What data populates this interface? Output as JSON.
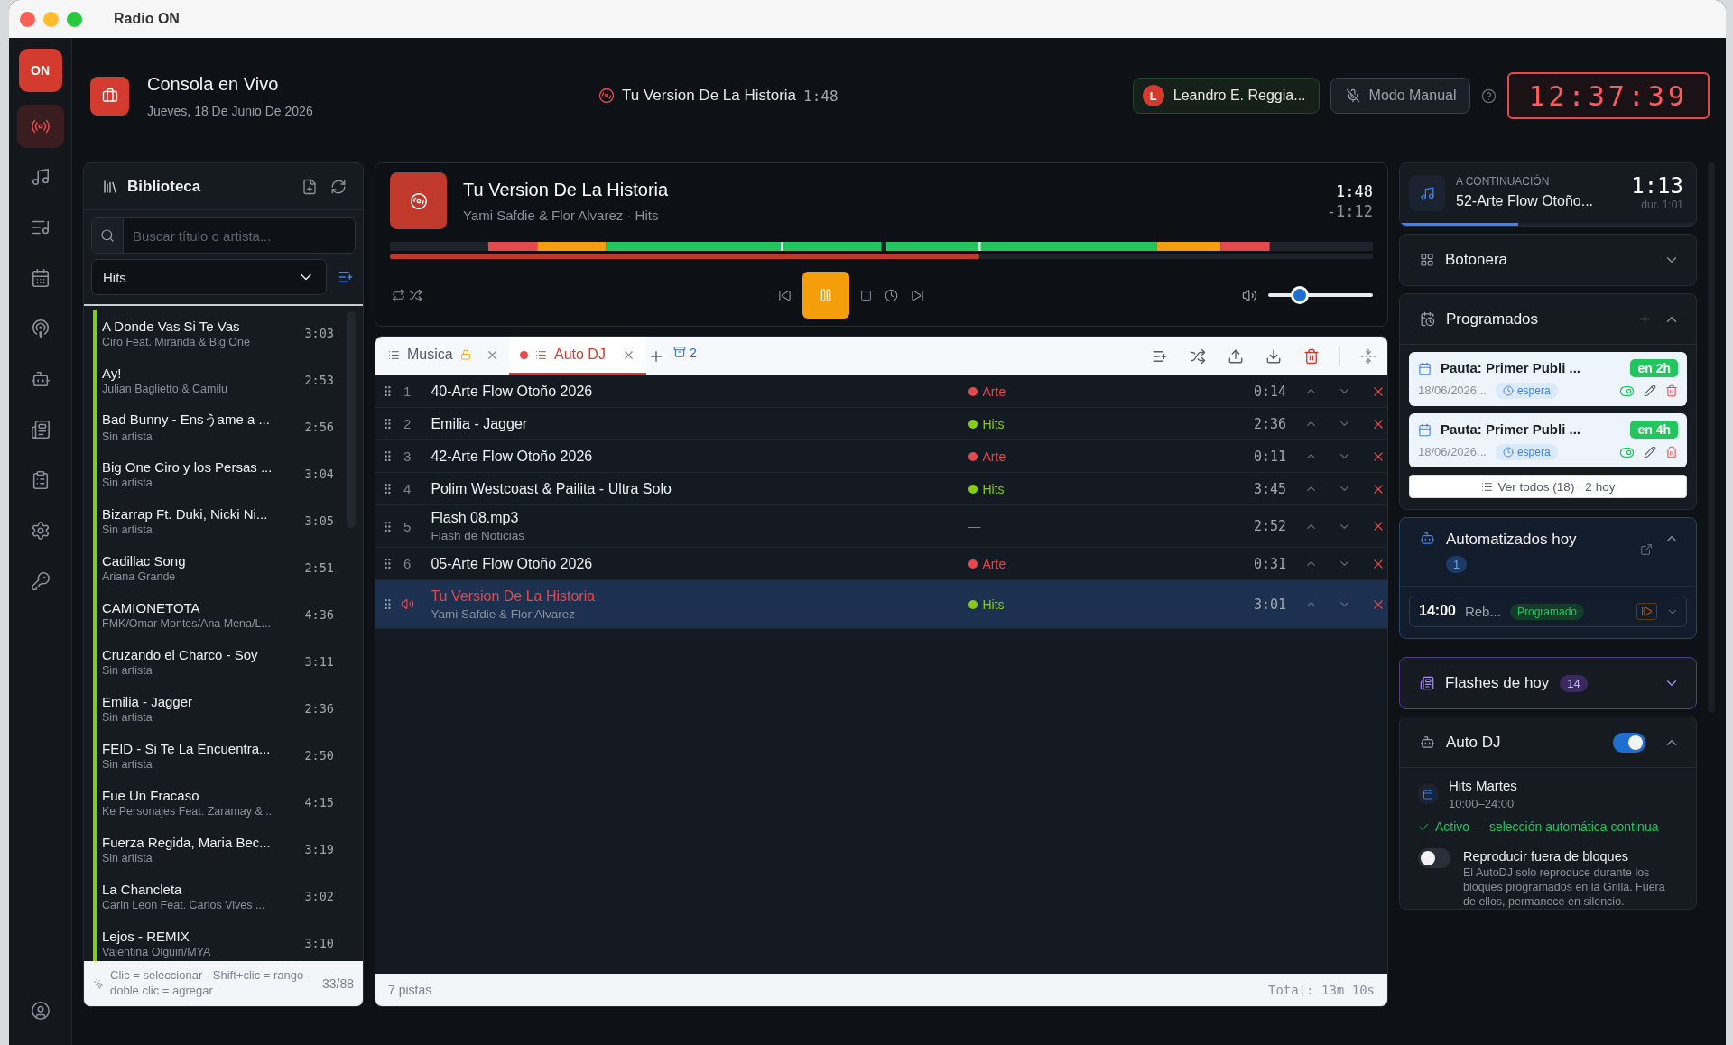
{
  "window": {
    "title": "Radio ON"
  },
  "rail": {
    "logo": "ON",
    "items": [
      {
        "selected": true
      },
      {
        "selected": false
      },
      {
        "selected": false
      },
      {
        "selected": false
      },
      {
        "selected": false
      },
      {
        "selected": false
      },
      {
        "selected": false
      },
      {
        "selected": false
      },
      {
        "selected": false
      },
      {
        "selected": false
      }
    ]
  },
  "header": {
    "title": "Consola en Vivo",
    "date": "Jueves, 18 De Junio De 2026",
    "now_playing": {
      "title": "Tu Version De La Historia",
      "time": "1:48"
    },
    "user": {
      "initial": "L",
      "name": "Leandro E. Reggia..."
    },
    "mode_button": "Modo Manual",
    "clock": "12:37:39"
  },
  "library": {
    "title": "Biblioteca",
    "search": {
      "placeholder": "Buscar título o artista..."
    },
    "filter": "Hits",
    "tracks": [
      {
        "title": "A Donde Vas Si Te Vas",
        "artist": "Ciro Feat. Miranda & Big One",
        "duration": "3:03"
      },
      {
        "title": "Ay!",
        "artist": "Julian Baglietto & Camilu",
        "duration": "2:53"
      },
      {
        "title": "Bad Bunny - Ensうame a ...",
        "artist": "Sin artista",
        "duration": "2:56"
      },
      {
        "title": "Big One Ciro y los Persas ...",
        "artist": "Sin artista",
        "duration": "3:04"
      },
      {
        "title": "Bizarrap Ft. Duki, Nicki Ni...",
        "artist": "Sin artista",
        "duration": "3:05"
      },
      {
        "title": "Cadillac Song",
        "artist": "Ariana Grande",
        "duration": "2:51"
      },
      {
        "title": "CAMIONETOTA",
        "artist": "FMK/Omar Montes/Ana Mena/L...",
        "duration": "4:36"
      },
      {
        "title": "Cruzando el Charco - Soy",
        "artist": "Sin artista",
        "duration": "3:11"
      },
      {
        "title": "Emilia - Jagger",
        "artist": "Sin artista",
        "duration": "2:36"
      },
      {
        "title": "FEID - Si Te La Encuentra...",
        "artist": "Sin artista",
        "duration": "2:50"
      },
      {
        "title": "Fue Un Fracaso",
        "artist": "Ke Personajes Feat. Zaramay &...",
        "duration": "4:15"
      },
      {
        "title": "Fuerza Regida, Maria Bec...",
        "artist": "Sin artista",
        "duration": "3:19"
      },
      {
        "title": "La Chancleta",
        "artist": "Carin Leon Feat. Carlos Vives ...",
        "duration": "3:02"
      },
      {
        "title": "Lejos - REMIX",
        "artist": "Valentina Olguin/MYA",
        "duration": "3:10"
      }
    ],
    "hint": "Clic = seleccionar · Shift+clic = rango · doble clic = agregar",
    "count": "33/88"
  },
  "player": {
    "title": "Tu Version De La Historia",
    "subtitle": "Yami Safdie & Flor Alvarez · Hits",
    "elapsed": "1:48",
    "remaining": "-1:12",
    "level": 0.6,
    "playing": true,
    "volume": {
      "level": 0.3
    }
  },
  "playlist": {
    "tabs": [
      {
        "label": "Musica",
        "selected": false,
        "live": false,
        "locked": true
      },
      {
        "label": "Auto DJ",
        "selected": true,
        "live": true,
        "locked": false
      }
    ],
    "archived": "2",
    "rows": [
      {
        "number": "1",
        "title": "40-Arte Flow Otoño 2026",
        "category": "Arte",
        "color": "#e5484d",
        "duration": "0:14",
        "playing": false
      },
      {
        "number": "2",
        "title": "Emilia - Jagger",
        "category": "Hits",
        "color": "#84cc16",
        "duration": "2:36",
        "playing": false
      },
      {
        "number": "3",
        "title": "42-Arte Flow Otoño 2026",
        "category": "Arte",
        "color": "#e5484d",
        "duration": "0:11",
        "playing": false
      },
      {
        "number": "4",
        "title": "Polim  Westcoast & Pailita - Ultra Solo",
        "category": "Hits",
        "color": "#84cc16",
        "duration": "3:45",
        "playing": false
      },
      {
        "number": "5",
        "title": "Flash 08.mp3",
        "subtitle": "Flash de Noticias",
        "category": "—",
        "duration": "2:52",
        "playing": false
      },
      {
        "number": "6",
        "title": "05-Arte Flow Otoño 2026",
        "category": "Arte",
        "color": "#e5484d",
        "duration": "0:31",
        "playing": false
      },
      {
        "title": "Tu Version De La Historia",
        "subtitle": "Yami Safdie & Flor Alvarez",
        "category": "Hits",
        "color": "#84cc16",
        "duration": "3:01",
        "playing": true
      }
    ],
    "footer": {
      "count": "7 pistas",
      "total": "Total: 13m 10s"
    }
  },
  "side": {
    "next": {
      "label": "A CONTINUACIÓN",
      "title": "52-Arte Flow Otoño...",
      "countdown": "1:13",
      "duration": "dur. 1:01",
      "level": 0.4
    },
    "botonera": {
      "title": "Botonera",
      "expanded": false
    },
    "programados": {
      "title": "Programados",
      "expanded": true,
      "items": [
        {
          "title": "Pauta: Primer Publi ...",
          "badge": "en 2h",
          "date": "18/06/2026...",
          "status": "espera",
          "enabled": true
        },
        {
          "title": "Pauta: Primer Publi ...",
          "badge": "en 4h",
          "date": "18/06/2026...",
          "status": "espera",
          "enabled": true
        }
      ],
      "link": "Ver todos (18) · 2 hoy"
    },
    "automatizados": {
      "title": "Automatizados hoy",
      "count": "1",
      "expanded": true,
      "items": [
        {
          "time": "14:00",
          "title": "Reb...",
          "status": "Programado"
        }
      ]
    },
    "flashes": {
      "title": "Flashes de hoy",
      "count": "14",
      "expanded": false
    },
    "autodj": {
      "title": "Auto DJ",
      "on": true,
      "expanded": true,
      "block": {
        "name": "Hits Martes",
        "hours": "10:00–24:00"
      },
      "status": "Activo — selección automática continua",
      "option": {
        "label": "Reproducir fuera de bloques",
        "on": false,
        "description": "El AutoDJ solo reproduce durante los bloques programados en la Grilla. Fuera de ellos, permanece en silencio."
      }
    }
  }
}
